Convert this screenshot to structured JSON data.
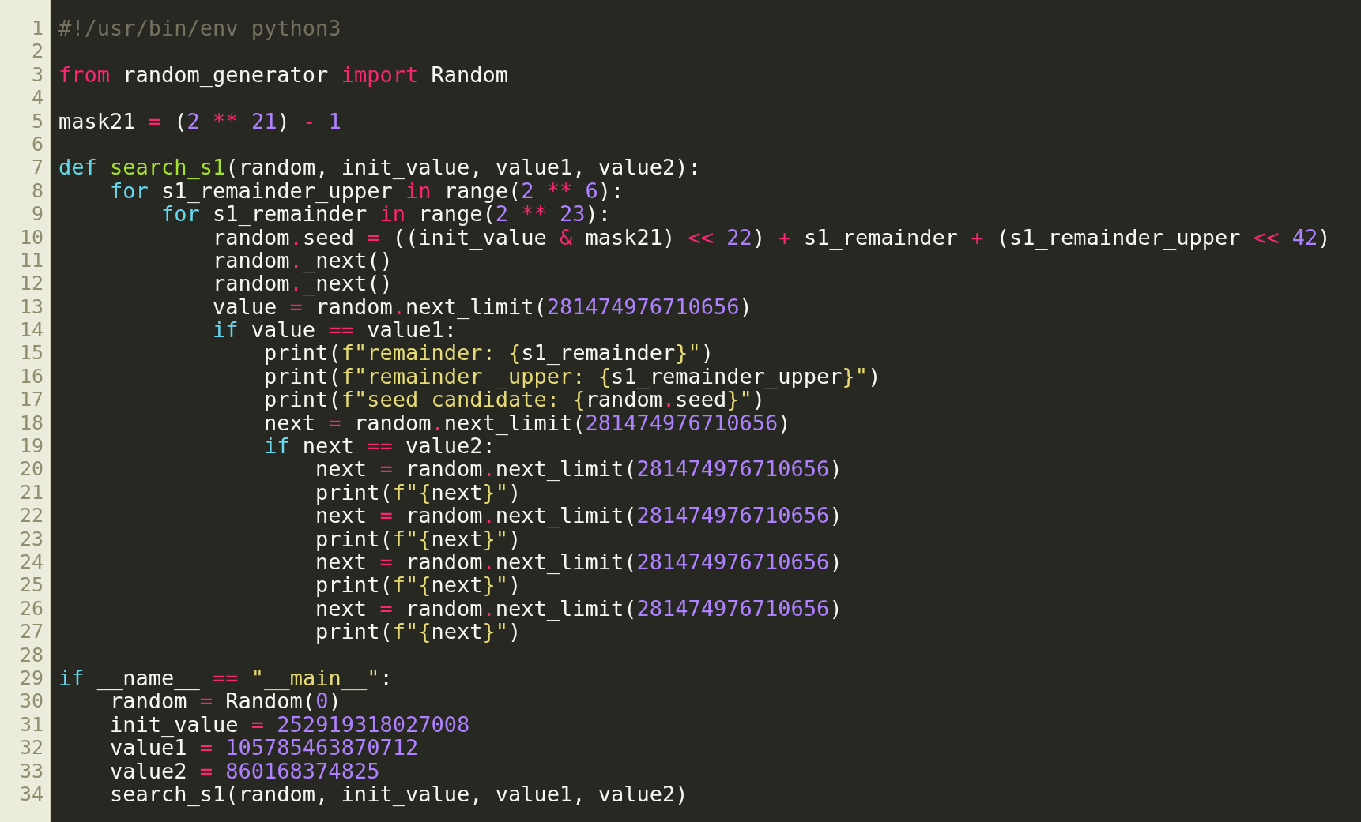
{
  "editor": {
    "lines": [
      {
        "number": "1",
        "tokens": [
          {
            "kind": "comment",
            "text": "#!/usr/bin/env python3"
          }
        ]
      },
      {
        "number": "2"
      },
      {
        "number": "3",
        "tokens": [
          {
            "kind": "keyword",
            "text": "from"
          },
          {
            "kind": "plain",
            "text": " random_generator "
          },
          {
            "kind": "keyword",
            "text": "import"
          },
          {
            "kind": "plain",
            "text": " Random"
          }
        ]
      },
      {
        "number": "4"
      },
      {
        "number": "5",
        "tokens": [
          {
            "kind": "plain",
            "text": "mask21 "
          },
          {
            "kind": "operator",
            "text": "="
          },
          {
            "kind": "plain",
            "text": " ("
          },
          {
            "kind": "number",
            "text": "2"
          },
          {
            "kind": "operator",
            "text": " ** "
          },
          {
            "kind": "number",
            "text": "21"
          },
          {
            "kind": "plain",
            "text": ") "
          },
          {
            "kind": "operator",
            "text": "- "
          },
          {
            "kind": "number",
            "text": "1"
          }
        ]
      },
      {
        "number": "6"
      },
      {
        "number": "7",
        "tokens": [
          {
            "kind": "storage",
            "text": "def "
          },
          {
            "kind": "function",
            "text": "search_s1"
          },
          {
            "kind": "plain",
            "text": "(random, init_value, value1, value2):"
          }
        ]
      },
      {
        "number": "8",
        "tokens": [
          {
            "kind": "storage",
            "text": "    for"
          },
          {
            "kind": "plain",
            "text": " s1_remainder_upper "
          },
          {
            "kind": "keyword",
            "text": "in"
          },
          {
            "kind": "plain",
            "text": " range("
          },
          {
            "kind": "number",
            "text": "2"
          },
          {
            "kind": "operator",
            "text": " ** "
          },
          {
            "kind": "number",
            "text": "6"
          },
          {
            "kind": "plain",
            "text": "):"
          }
        ]
      },
      {
        "number": "9",
        "tokens": [
          {
            "kind": "storage",
            "text": "        for"
          },
          {
            "kind": "plain",
            "text": " s1_remainder "
          },
          {
            "kind": "keyword",
            "text": "in"
          },
          {
            "kind": "plain",
            "text": " range("
          },
          {
            "kind": "number",
            "text": "2"
          },
          {
            "kind": "operator",
            "text": " ** "
          },
          {
            "kind": "number",
            "text": "23"
          },
          {
            "kind": "plain",
            "text": "):"
          }
        ]
      },
      {
        "number": "10",
        "tokens": [
          {
            "kind": "plain",
            "text": "            random"
          },
          {
            "kind": "operator",
            "text": "."
          },
          {
            "kind": "plain",
            "text": "seed "
          },
          {
            "kind": "operator",
            "text": "="
          },
          {
            "kind": "plain",
            "text": " ((init_value "
          },
          {
            "kind": "operator",
            "text": "&"
          },
          {
            "kind": "plain",
            "text": " mask21) "
          },
          {
            "kind": "operator",
            "text": "<< "
          },
          {
            "kind": "number",
            "text": "22"
          },
          {
            "kind": "plain",
            "text": ") "
          },
          {
            "kind": "operator",
            "text": "+"
          },
          {
            "kind": "plain",
            "text": " s1_remainder "
          },
          {
            "kind": "operator",
            "text": "+"
          },
          {
            "kind": "plain",
            "text": " (s1_remainder_upper "
          },
          {
            "kind": "operator",
            "text": "<< "
          },
          {
            "kind": "number",
            "text": "42"
          },
          {
            "kind": "plain",
            "text": ")"
          }
        ]
      },
      {
        "number": "11",
        "tokens": [
          {
            "kind": "plain",
            "text": "            random"
          },
          {
            "kind": "operator",
            "text": "."
          },
          {
            "kind": "plain",
            "text": "_next()"
          }
        ]
      },
      {
        "number": "12",
        "tokens": [
          {
            "kind": "plain",
            "text": "            random"
          },
          {
            "kind": "operator",
            "text": "."
          },
          {
            "kind": "plain",
            "text": "_next()"
          }
        ]
      },
      {
        "number": "13",
        "tokens": [
          {
            "kind": "plain",
            "text": "            value "
          },
          {
            "kind": "operator",
            "text": "="
          },
          {
            "kind": "plain",
            "text": " random"
          },
          {
            "kind": "operator",
            "text": "."
          },
          {
            "kind": "plain",
            "text": "next_limit("
          },
          {
            "kind": "number",
            "text": "281474976710656"
          },
          {
            "kind": "plain",
            "text": ")"
          }
        ]
      },
      {
        "number": "14",
        "tokens": [
          {
            "kind": "storage",
            "text": "            if"
          },
          {
            "kind": "plain",
            "text": " value "
          },
          {
            "kind": "operator",
            "text": "=="
          },
          {
            "kind": "plain",
            "text": " value1:"
          }
        ]
      },
      {
        "number": "15",
        "tokens": [
          {
            "kind": "plain",
            "text": "                print("
          },
          {
            "kind": "string",
            "text": "f\"remainder: {"
          },
          {
            "kind": "plain",
            "text": "s1_remainder"
          },
          {
            "kind": "string",
            "text": "}\""
          },
          {
            "kind": "plain",
            "text": ")"
          }
        ]
      },
      {
        "number": "16",
        "tokens": [
          {
            "kind": "plain",
            "text": "                print("
          },
          {
            "kind": "string",
            "text": "f\"remainder _upper: {"
          },
          {
            "kind": "plain",
            "text": "s1_remainder_upper"
          },
          {
            "kind": "string",
            "text": "}\""
          },
          {
            "kind": "plain",
            "text": ")"
          }
        ]
      },
      {
        "number": "17",
        "tokens": [
          {
            "kind": "plain",
            "text": "                print("
          },
          {
            "kind": "string",
            "text": "f\"seed candidate: {"
          },
          {
            "kind": "plain",
            "text": "random"
          },
          {
            "kind": "operator",
            "text": "."
          },
          {
            "kind": "plain",
            "text": "seed"
          },
          {
            "kind": "string",
            "text": "}\""
          },
          {
            "kind": "plain",
            "text": ")"
          }
        ]
      },
      {
        "number": "18",
        "tokens": [
          {
            "kind": "plain",
            "text": "                next "
          },
          {
            "kind": "operator",
            "text": "="
          },
          {
            "kind": "plain",
            "text": " random"
          },
          {
            "kind": "operator",
            "text": "."
          },
          {
            "kind": "plain",
            "text": "next_limit("
          },
          {
            "kind": "number",
            "text": "281474976710656"
          },
          {
            "kind": "plain",
            "text": ")"
          }
        ]
      },
      {
        "number": "19",
        "tokens": [
          {
            "kind": "storage",
            "text": "                if"
          },
          {
            "kind": "plain",
            "text": " next "
          },
          {
            "kind": "operator",
            "text": "=="
          },
          {
            "kind": "plain",
            "text": " value2:"
          }
        ]
      },
      {
        "number": "20",
        "tokens": [
          {
            "kind": "plain",
            "text": "                    next "
          },
          {
            "kind": "operator",
            "text": "="
          },
          {
            "kind": "plain",
            "text": " random"
          },
          {
            "kind": "operator",
            "text": "."
          },
          {
            "kind": "plain",
            "text": "next_limit("
          },
          {
            "kind": "number",
            "text": "281474976710656"
          },
          {
            "kind": "plain",
            "text": ")"
          }
        ]
      },
      {
        "number": "21",
        "tokens": [
          {
            "kind": "plain",
            "text": "                    print("
          },
          {
            "kind": "string",
            "text": "f\"{"
          },
          {
            "kind": "plain",
            "text": "next"
          },
          {
            "kind": "string",
            "text": "}\""
          },
          {
            "kind": "plain",
            "text": ")"
          }
        ]
      },
      {
        "number": "22",
        "tokens": [
          {
            "kind": "plain",
            "text": "                    next "
          },
          {
            "kind": "operator",
            "text": "="
          },
          {
            "kind": "plain",
            "text": " random"
          },
          {
            "kind": "operator",
            "text": "."
          },
          {
            "kind": "plain",
            "text": "next_limit("
          },
          {
            "kind": "number",
            "text": "281474976710656"
          },
          {
            "kind": "plain",
            "text": ")"
          }
        ]
      },
      {
        "number": "23",
        "tokens": [
          {
            "kind": "plain",
            "text": "                    print("
          },
          {
            "kind": "string",
            "text": "f\"{"
          },
          {
            "kind": "plain",
            "text": "next"
          },
          {
            "kind": "string",
            "text": "}\""
          },
          {
            "kind": "plain",
            "text": ")"
          }
        ]
      },
      {
        "number": "24",
        "tokens": [
          {
            "kind": "plain",
            "text": "                    next "
          },
          {
            "kind": "operator",
            "text": "="
          },
          {
            "kind": "plain",
            "text": " random"
          },
          {
            "kind": "operator",
            "text": "."
          },
          {
            "kind": "plain",
            "text": "next_limit("
          },
          {
            "kind": "number",
            "text": "281474976710656"
          },
          {
            "kind": "plain",
            "text": ")"
          }
        ]
      },
      {
        "number": "25",
        "tokens": [
          {
            "kind": "plain",
            "text": "                    print("
          },
          {
            "kind": "string",
            "text": "f\"{"
          },
          {
            "kind": "plain",
            "text": "next"
          },
          {
            "kind": "string",
            "text": "}\""
          },
          {
            "kind": "plain",
            "text": ")"
          }
        ]
      },
      {
        "number": "26",
        "tokens": [
          {
            "kind": "plain",
            "text": "                    next "
          },
          {
            "kind": "operator",
            "text": "="
          },
          {
            "kind": "plain",
            "text": " random"
          },
          {
            "kind": "operator",
            "text": "."
          },
          {
            "kind": "plain",
            "text": "next_limit("
          },
          {
            "kind": "number",
            "text": "281474976710656"
          },
          {
            "kind": "plain",
            "text": ")"
          }
        ]
      },
      {
        "number": "27",
        "tokens": [
          {
            "kind": "plain",
            "text": "                    print("
          },
          {
            "kind": "string",
            "text": "f\"{"
          },
          {
            "kind": "plain",
            "text": "next"
          },
          {
            "kind": "string",
            "text": "}\""
          },
          {
            "kind": "plain",
            "text": ")"
          }
        ]
      },
      {
        "number": "28"
      },
      {
        "number": "29",
        "tokens": [
          {
            "kind": "storage",
            "text": "if"
          },
          {
            "kind": "plain",
            "text": " __name__ "
          },
          {
            "kind": "operator",
            "text": "== "
          },
          {
            "kind": "string",
            "text": "\"__main__\""
          },
          {
            "kind": "plain",
            "text": ":"
          }
        ]
      },
      {
        "number": "30",
        "tokens": [
          {
            "kind": "plain",
            "text": "    random "
          },
          {
            "kind": "operator",
            "text": "="
          },
          {
            "kind": "plain",
            "text": " Random("
          },
          {
            "kind": "number",
            "text": "0"
          },
          {
            "kind": "plain",
            "text": ")"
          }
        ]
      },
      {
        "number": "31",
        "tokens": [
          {
            "kind": "plain",
            "text": "    init_value "
          },
          {
            "kind": "operator",
            "text": "= "
          },
          {
            "kind": "number",
            "text": "252919318027008"
          }
        ]
      },
      {
        "number": "32",
        "tokens": [
          {
            "kind": "plain",
            "text": "    value1 "
          },
          {
            "kind": "operator",
            "text": "= "
          },
          {
            "kind": "number",
            "text": "105785463870712"
          }
        ]
      },
      {
        "number": "33",
        "tokens": [
          {
            "kind": "plain",
            "text": "    value2 "
          },
          {
            "kind": "operator",
            "text": "= "
          },
          {
            "kind": "number",
            "text": "860168374825"
          }
        ]
      },
      {
        "number": "34",
        "tokens": [
          {
            "kind": "plain",
            "text": "    search_s1(random, init_value, value1, value2)"
          }
        ]
      }
    ]
  }
}
